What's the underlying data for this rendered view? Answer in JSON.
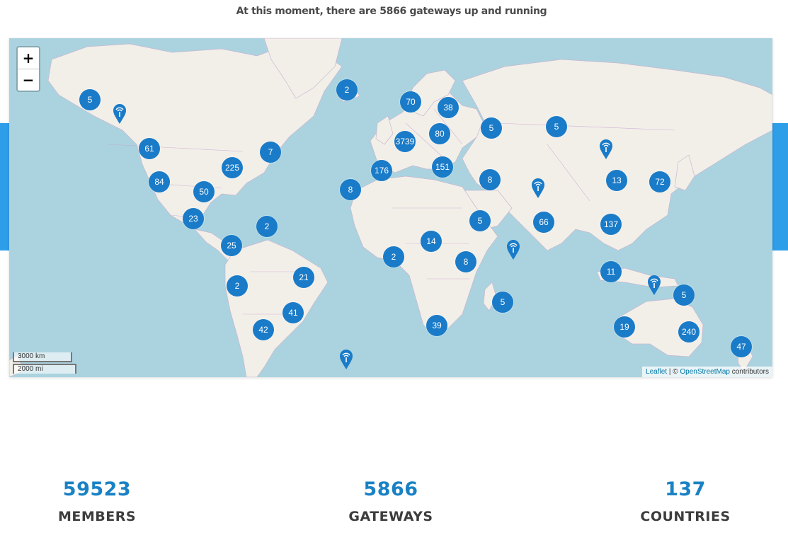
{
  "headline": "At this moment, there are 5866 gateways up and running",
  "map": {
    "zoom_in_label": "+",
    "zoom_out_label": "−",
    "scale_km": "3000 km",
    "scale_mi": "2000 mi",
    "attribution": {
      "leaflet": "Leaflet",
      "separator": " | © ",
      "osm": "OpenStreetMap",
      "suffix": " contributors"
    },
    "clusters": [
      {
        "count": "5"
      },
      {
        "count": "2"
      },
      {
        "count": "70"
      },
      {
        "count": "38"
      },
      {
        "count": "5"
      },
      {
        "count": "5"
      },
      {
        "count": "80"
      },
      {
        "count": "61"
      },
      {
        "count": "7"
      },
      {
        "count": "3739"
      },
      {
        "count": "225"
      },
      {
        "count": "176"
      },
      {
        "count": "151"
      },
      {
        "count": "84"
      },
      {
        "count": "50"
      },
      {
        "count": "8"
      },
      {
        "count": "8"
      },
      {
        "count": "13"
      },
      {
        "count": "72"
      },
      {
        "count": "23"
      },
      {
        "count": "2"
      },
      {
        "count": "5"
      },
      {
        "count": "66"
      },
      {
        "count": "137"
      },
      {
        "count": "25"
      },
      {
        "count": "14"
      },
      {
        "count": "2"
      },
      {
        "count": "8"
      },
      {
        "count": "11"
      },
      {
        "count": "21"
      },
      {
        "count": "2"
      },
      {
        "count": "5"
      },
      {
        "count": "5"
      },
      {
        "count": "41"
      },
      {
        "count": "42"
      },
      {
        "count": "39"
      },
      {
        "count": "19"
      },
      {
        "count": "240"
      },
      {
        "count": "47"
      }
    ],
    "pin_icon": "gateway-pin-icon",
    "marker_color": "#1a7bc8"
  },
  "stats": [
    {
      "value": "59523",
      "label": "MEMBERS"
    },
    {
      "value": "5866",
      "label": "GATEWAYS"
    },
    {
      "value": "137",
      "label": "COUNTRIES"
    }
  ],
  "colors": {
    "accent": "#1a82c4",
    "band": "#2f9ee8",
    "water": "#aad3df",
    "land": "#f2efe9"
  }
}
